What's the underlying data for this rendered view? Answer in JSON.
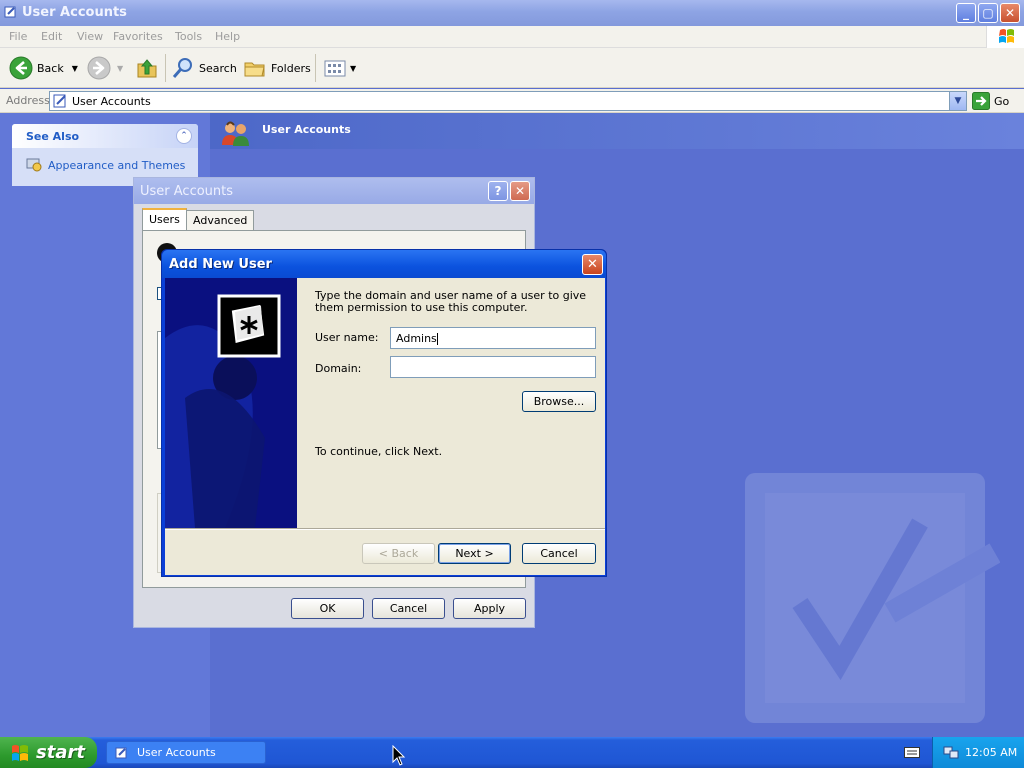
{
  "window": {
    "title": "User Accounts",
    "minimize_label": "_",
    "maximize_label": "▢",
    "close_label": "✕"
  },
  "menu": {
    "items": [
      "File",
      "Edit",
      "View",
      "Favorites",
      "Tools",
      "Help"
    ]
  },
  "toolbar": {
    "back_label": "Back",
    "search_label": "Search",
    "folders_label": "Folders"
  },
  "address": {
    "label": "Address",
    "value": "User Accounts",
    "go_label": "Go"
  },
  "see_also": {
    "title": "See Also",
    "collapse_icon": "⌃",
    "link": "Appearance and Themes"
  },
  "header": {
    "title": "User Accounts"
  },
  "user_accounts_dialog": {
    "title": "User Accounts",
    "help_label": "?",
    "close_label": "✕",
    "tabs": [
      "Users",
      "Advanced"
    ],
    "buttons": {
      "ok": "OK",
      "cancel": "Cancel",
      "apply": "Apply"
    }
  },
  "add_user_dialog": {
    "title": "Add New User",
    "close_label": "✕",
    "instructions": "Type the domain and user name of a user to give them permission to use this computer.",
    "user_name_label": "User name:",
    "user_name_value": "Admins",
    "domain_label": "Domain:",
    "domain_value": "",
    "browse_label": "Browse...",
    "continue_text": "To continue, click Next.",
    "back_label": "< Back",
    "next_label": "Next >",
    "cancel_label": "Cancel"
  },
  "taskbar": {
    "start_label": "start",
    "task_label": "User Accounts",
    "clock": "12:05 AM"
  },
  "colors": {
    "desktop_blue": "#5a6fd0",
    "xp_title_blue": "#0b52de",
    "start_green": "#2d9a2d"
  }
}
